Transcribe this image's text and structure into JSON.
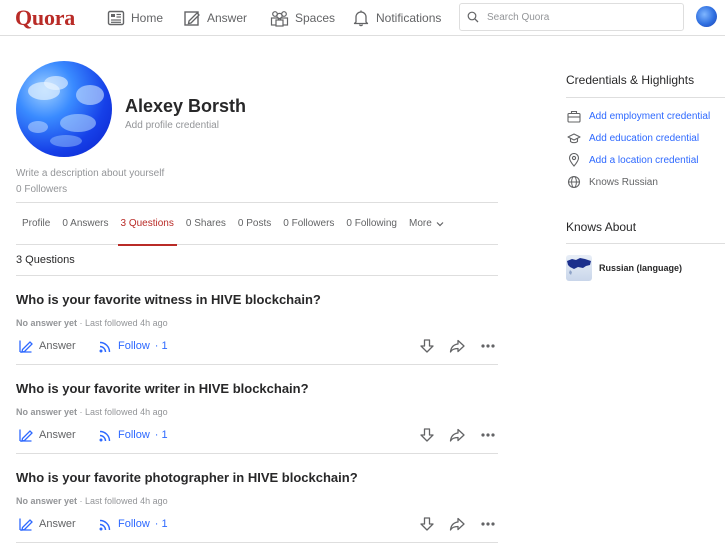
{
  "header": {
    "logo": "Quora",
    "nav": [
      {
        "label": "Home",
        "icon": "home-icon"
      },
      {
        "label": "Answer",
        "icon": "answer-icon"
      },
      {
        "label": "Spaces",
        "icon": "spaces-icon"
      },
      {
        "label": "Notifications",
        "icon": "bell-icon"
      }
    ],
    "search_placeholder": "Search Quora"
  },
  "profile": {
    "name": "Alexey Borsth",
    "credential_placeholder": "Add profile credential",
    "description_placeholder": "Write a description about yourself",
    "followers": "0 Followers"
  },
  "tabs": [
    {
      "label": "Profile",
      "active": false
    },
    {
      "label": "0 Answers",
      "active": false
    },
    {
      "label": "3 Questions",
      "active": true
    },
    {
      "label": "0 Shares",
      "active": false
    },
    {
      "label": "0 Posts",
      "active": false
    },
    {
      "label": "0 Followers",
      "active": false
    },
    {
      "label": "0 Following",
      "active": false
    },
    {
      "label": "More",
      "active": false
    }
  ],
  "questions_heading": "3 Questions",
  "questions": [
    {
      "title": "Who is your favorite witness in HIVE blockchain?",
      "status": "No answer yet",
      "followed": "· Last followed 4h ago",
      "answer_label": "Answer",
      "follow_label": "Follow",
      "follow_count": "· 1"
    },
    {
      "title": "Who is your favorite writer in HIVE blockchain?",
      "status": "No answer yet",
      "followed": "· Last followed 4h ago",
      "answer_label": "Answer",
      "follow_label": "Follow",
      "follow_count": "· 1"
    },
    {
      "title": "Who is your favorite photographer in HIVE blockchain?",
      "status": "No answer yet",
      "followed": "· Last followed 4h ago",
      "answer_label": "Answer",
      "follow_label": "Follow",
      "follow_count": "· 1"
    }
  ],
  "sidebar": {
    "credentials_title": "Credentials & Highlights",
    "credentials": [
      {
        "label": "Add employment credential",
        "icon": "briefcase-icon",
        "link": true
      },
      {
        "label": "Add education credential",
        "icon": "graduation-cap-icon",
        "link": true
      },
      {
        "label": "Add a location credential",
        "icon": "location-pin-icon",
        "link": true
      },
      {
        "label": "Knows Russian",
        "icon": "globe-icon",
        "link": false
      }
    ],
    "knows_about_title": "Knows About",
    "knows_about": [
      {
        "label": "Russian (language)",
        "icon": "russia-map-icon"
      }
    ]
  },
  "colors": {
    "brand": "#b92b27",
    "link": "#2e69ff",
    "muted": "#939598",
    "border": "#dedede"
  }
}
